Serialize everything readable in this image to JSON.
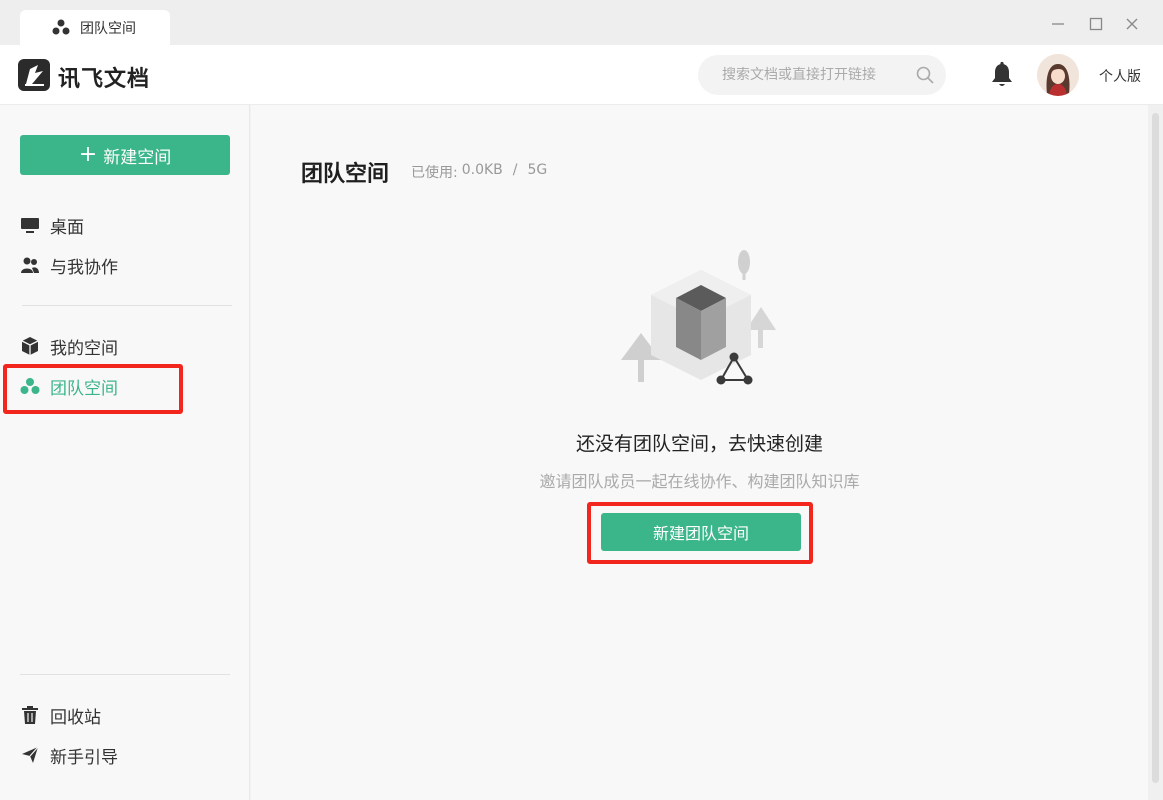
{
  "window": {
    "tab_label": "团队空间",
    "tab_icon": "team-icon"
  },
  "header": {
    "brand": "讯飞文档",
    "search_placeholder": "搜索文档或直接打开链接",
    "plan_label": "个人版"
  },
  "sidebar": {
    "new_space_label": "新建空间",
    "items": [
      {
        "label": "桌面",
        "icon": "desktop-icon"
      },
      {
        "label": "与我协作",
        "icon": "collaborators-icon"
      },
      {
        "label": "我的空间",
        "icon": "cube-icon"
      },
      {
        "label": "团队空间",
        "icon": "team-icon",
        "active": true
      }
    ],
    "bottom_items": [
      {
        "label": "回收站",
        "icon": "trash-icon"
      },
      {
        "label": "新手引导",
        "icon": "paper-plane-icon"
      }
    ]
  },
  "main": {
    "title": "团队空间",
    "usage_label": "已使用:",
    "usage_used": "0.0KB",
    "usage_sep": "/",
    "usage_total": "5G",
    "empty_title": "还没有团队空间，去快速创建",
    "empty_subtitle": "邀请团队成员一起在线协作、构建团队知识库",
    "create_button": "新建团队空间"
  },
  "colors": {
    "accent": "#3bb58a",
    "highlight": "#f2261c"
  }
}
